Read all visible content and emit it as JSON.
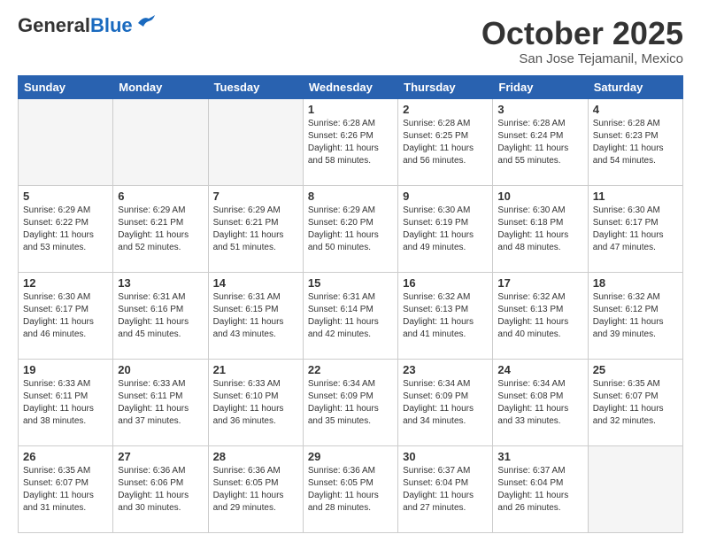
{
  "header": {
    "logo_general": "General",
    "logo_blue": "Blue",
    "month": "October 2025",
    "location": "San Jose Tejamanil, Mexico"
  },
  "weekdays": [
    "Sunday",
    "Monday",
    "Tuesday",
    "Wednesday",
    "Thursday",
    "Friday",
    "Saturday"
  ],
  "weeks": [
    [
      {
        "day": "",
        "info": ""
      },
      {
        "day": "",
        "info": ""
      },
      {
        "day": "",
        "info": ""
      },
      {
        "day": "1",
        "info": "Sunrise: 6:28 AM\nSunset: 6:26 PM\nDaylight: 11 hours\nand 58 minutes."
      },
      {
        "day": "2",
        "info": "Sunrise: 6:28 AM\nSunset: 6:25 PM\nDaylight: 11 hours\nand 56 minutes."
      },
      {
        "day": "3",
        "info": "Sunrise: 6:28 AM\nSunset: 6:24 PM\nDaylight: 11 hours\nand 55 minutes."
      },
      {
        "day": "4",
        "info": "Sunrise: 6:28 AM\nSunset: 6:23 PM\nDaylight: 11 hours\nand 54 minutes."
      }
    ],
    [
      {
        "day": "5",
        "info": "Sunrise: 6:29 AM\nSunset: 6:22 PM\nDaylight: 11 hours\nand 53 minutes."
      },
      {
        "day": "6",
        "info": "Sunrise: 6:29 AM\nSunset: 6:21 PM\nDaylight: 11 hours\nand 52 minutes."
      },
      {
        "day": "7",
        "info": "Sunrise: 6:29 AM\nSunset: 6:21 PM\nDaylight: 11 hours\nand 51 minutes."
      },
      {
        "day": "8",
        "info": "Sunrise: 6:29 AM\nSunset: 6:20 PM\nDaylight: 11 hours\nand 50 minutes."
      },
      {
        "day": "9",
        "info": "Sunrise: 6:30 AM\nSunset: 6:19 PM\nDaylight: 11 hours\nand 49 minutes."
      },
      {
        "day": "10",
        "info": "Sunrise: 6:30 AM\nSunset: 6:18 PM\nDaylight: 11 hours\nand 48 minutes."
      },
      {
        "day": "11",
        "info": "Sunrise: 6:30 AM\nSunset: 6:17 PM\nDaylight: 11 hours\nand 47 minutes."
      }
    ],
    [
      {
        "day": "12",
        "info": "Sunrise: 6:30 AM\nSunset: 6:17 PM\nDaylight: 11 hours\nand 46 minutes."
      },
      {
        "day": "13",
        "info": "Sunrise: 6:31 AM\nSunset: 6:16 PM\nDaylight: 11 hours\nand 45 minutes."
      },
      {
        "day": "14",
        "info": "Sunrise: 6:31 AM\nSunset: 6:15 PM\nDaylight: 11 hours\nand 43 minutes."
      },
      {
        "day": "15",
        "info": "Sunrise: 6:31 AM\nSunset: 6:14 PM\nDaylight: 11 hours\nand 42 minutes."
      },
      {
        "day": "16",
        "info": "Sunrise: 6:32 AM\nSunset: 6:13 PM\nDaylight: 11 hours\nand 41 minutes."
      },
      {
        "day": "17",
        "info": "Sunrise: 6:32 AM\nSunset: 6:13 PM\nDaylight: 11 hours\nand 40 minutes."
      },
      {
        "day": "18",
        "info": "Sunrise: 6:32 AM\nSunset: 6:12 PM\nDaylight: 11 hours\nand 39 minutes."
      }
    ],
    [
      {
        "day": "19",
        "info": "Sunrise: 6:33 AM\nSunset: 6:11 PM\nDaylight: 11 hours\nand 38 minutes."
      },
      {
        "day": "20",
        "info": "Sunrise: 6:33 AM\nSunset: 6:11 PM\nDaylight: 11 hours\nand 37 minutes."
      },
      {
        "day": "21",
        "info": "Sunrise: 6:33 AM\nSunset: 6:10 PM\nDaylight: 11 hours\nand 36 minutes."
      },
      {
        "day": "22",
        "info": "Sunrise: 6:34 AM\nSunset: 6:09 PM\nDaylight: 11 hours\nand 35 minutes."
      },
      {
        "day": "23",
        "info": "Sunrise: 6:34 AM\nSunset: 6:09 PM\nDaylight: 11 hours\nand 34 minutes."
      },
      {
        "day": "24",
        "info": "Sunrise: 6:34 AM\nSunset: 6:08 PM\nDaylight: 11 hours\nand 33 minutes."
      },
      {
        "day": "25",
        "info": "Sunrise: 6:35 AM\nSunset: 6:07 PM\nDaylight: 11 hours\nand 32 minutes."
      }
    ],
    [
      {
        "day": "26",
        "info": "Sunrise: 6:35 AM\nSunset: 6:07 PM\nDaylight: 11 hours\nand 31 minutes."
      },
      {
        "day": "27",
        "info": "Sunrise: 6:36 AM\nSunset: 6:06 PM\nDaylight: 11 hours\nand 30 minutes."
      },
      {
        "day": "28",
        "info": "Sunrise: 6:36 AM\nSunset: 6:05 PM\nDaylight: 11 hours\nand 29 minutes."
      },
      {
        "day": "29",
        "info": "Sunrise: 6:36 AM\nSunset: 6:05 PM\nDaylight: 11 hours\nand 28 minutes."
      },
      {
        "day": "30",
        "info": "Sunrise: 6:37 AM\nSunset: 6:04 PM\nDaylight: 11 hours\nand 27 minutes."
      },
      {
        "day": "31",
        "info": "Sunrise: 6:37 AM\nSunset: 6:04 PM\nDaylight: 11 hours\nand 26 minutes."
      },
      {
        "day": "",
        "info": ""
      }
    ]
  ]
}
